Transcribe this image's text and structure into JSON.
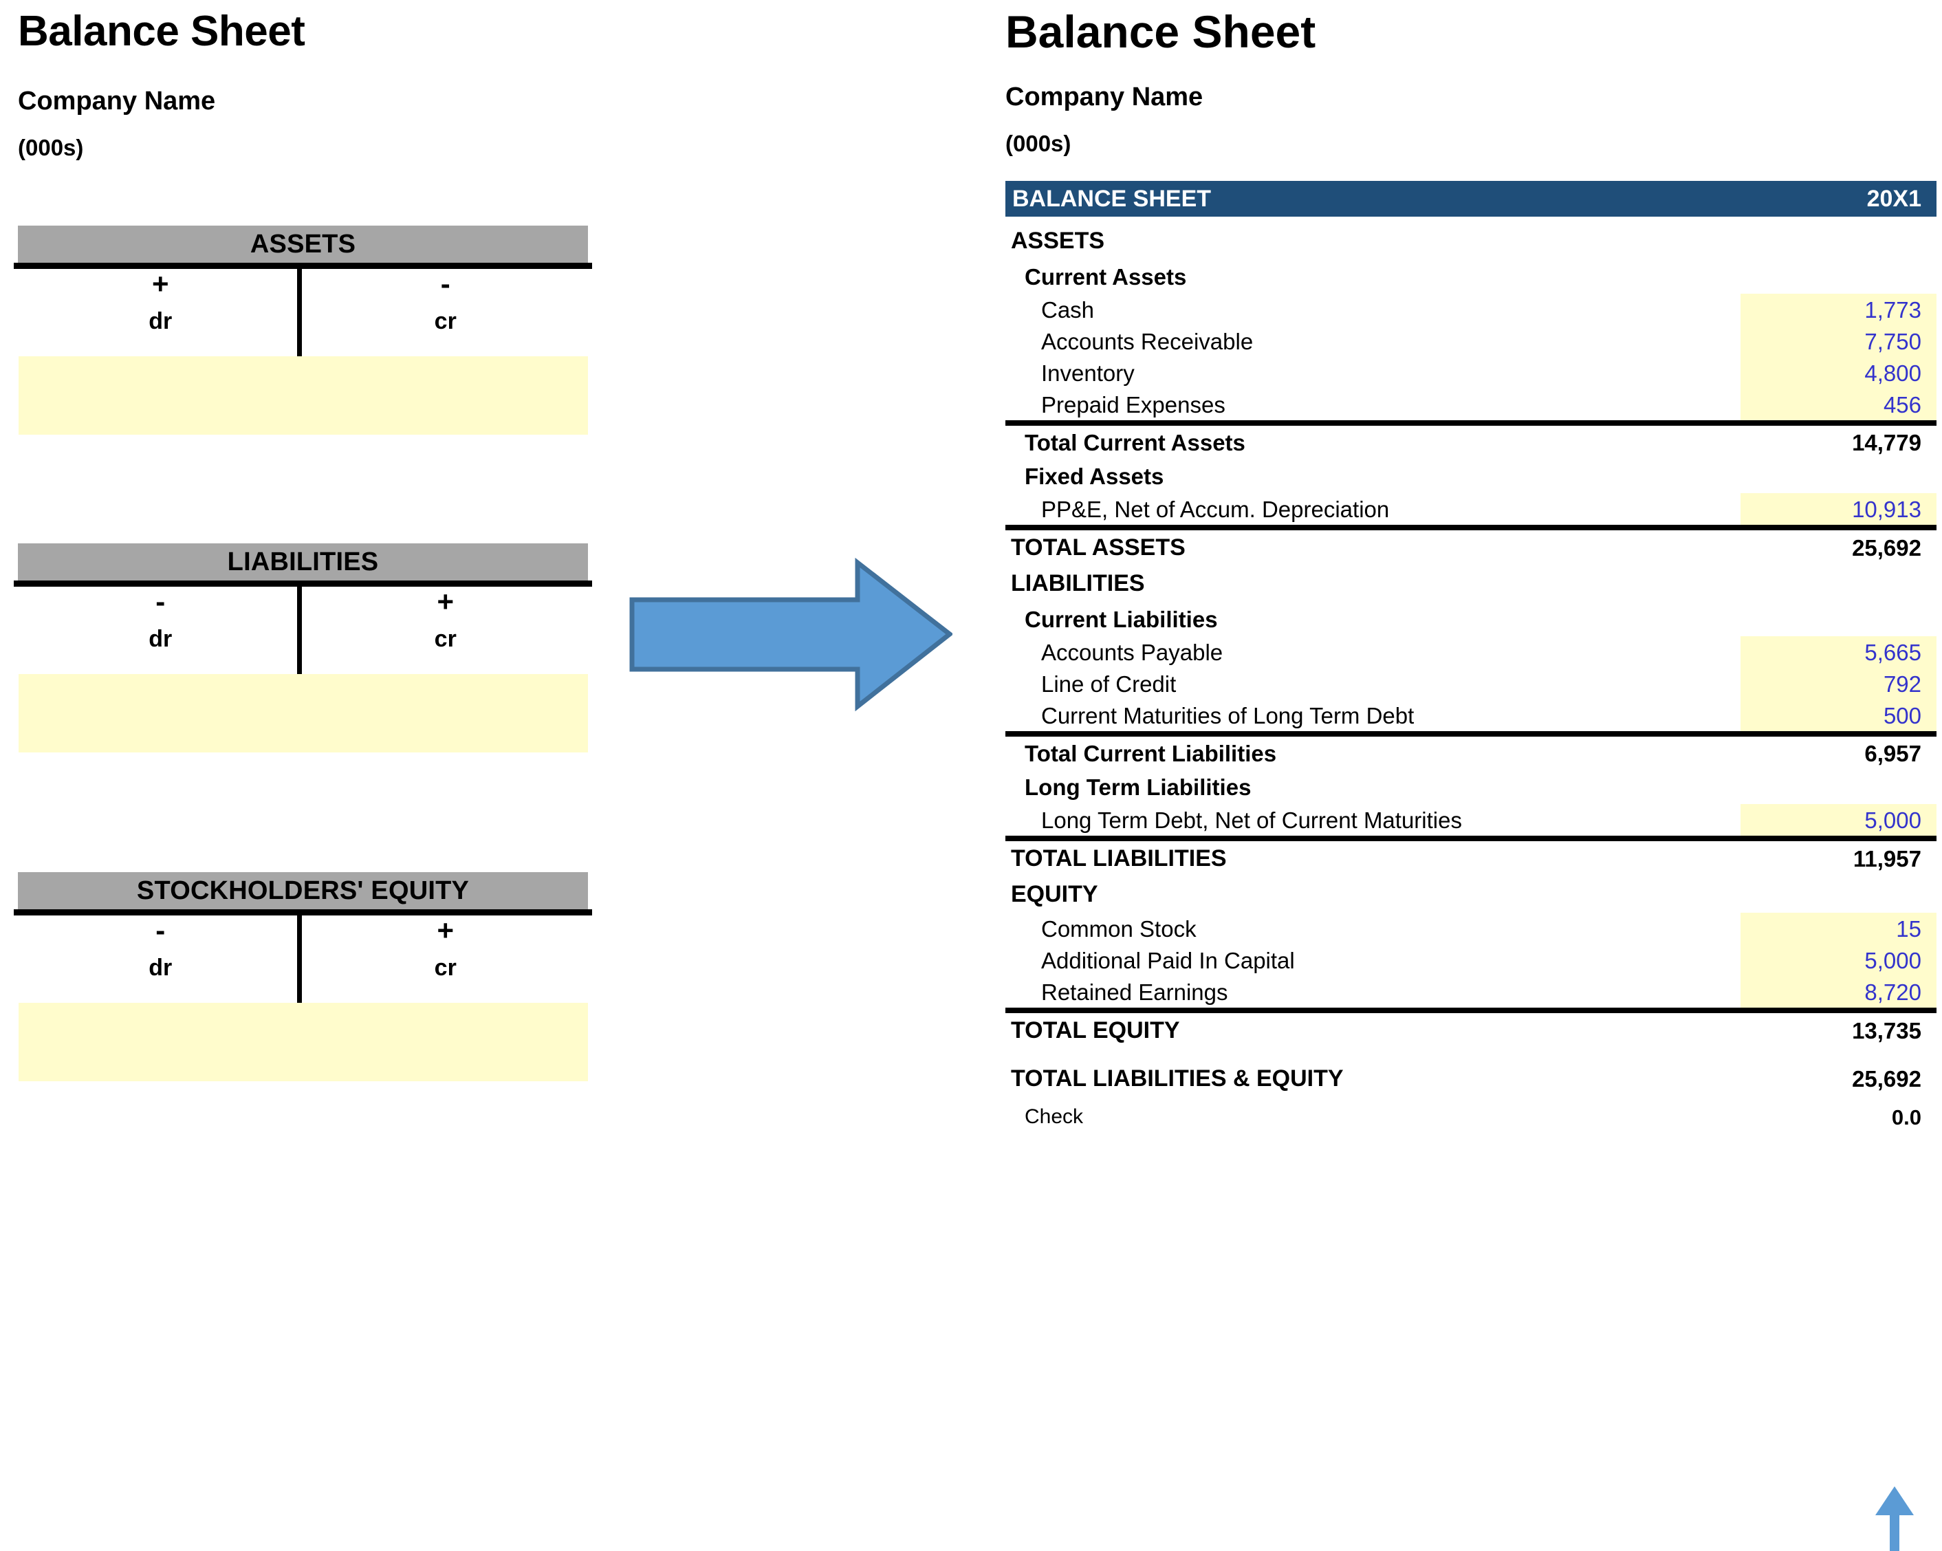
{
  "left": {
    "title": "Balance Sheet",
    "subtitle": "Company Name",
    "units": "(000s)",
    "t_accounts": [
      {
        "name": "ASSETS",
        "debit_sign": "+",
        "debit_label": "dr",
        "credit_sign": "-",
        "credit_label": "cr"
      },
      {
        "name": "LIABILITIES",
        "debit_sign": "-",
        "debit_label": "dr",
        "credit_sign": "+",
        "credit_label": "cr"
      },
      {
        "name": "STOCKHOLDERS' EQUITY",
        "debit_sign": "-",
        "debit_label": "dr",
        "credit_sign": "+",
        "credit_label": "cr"
      }
    ]
  },
  "arrow": {
    "direction": "right",
    "fill": "#5b9bd5",
    "stroke": "#41719c"
  },
  "small_arrow": {
    "direction": "up",
    "fill": "#5b9bd5"
  },
  "right": {
    "title": "Balance Sheet",
    "subtitle": "Company Name",
    "units": "(000s)",
    "header": {
      "label": "BALANCE SHEET",
      "period": "20X1",
      "bg": "#1f4e79",
      "fg": "#ffffff"
    },
    "highlight_color": "#fffccc",
    "input_value_color": "#3333cc",
    "rows": [
      {
        "type": "section",
        "label": "ASSETS",
        "value": ""
      },
      {
        "type": "subsection",
        "label": "Current Assets",
        "value": ""
      },
      {
        "type": "item",
        "label": "Cash",
        "value": "1,773"
      },
      {
        "type": "item",
        "label": "Accounts Receivable",
        "value": "7,750"
      },
      {
        "type": "item",
        "label": "Inventory",
        "value": "4,800"
      },
      {
        "type": "item",
        "label": "Prepaid Expenses",
        "value": "456"
      },
      {
        "type": "total",
        "label": "Total Current Assets",
        "value": "14,779"
      },
      {
        "type": "subsection",
        "label": "Fixed Assets",
        "value": ""
      },
      {
        "type": "item",
        "label": "PP&E, Net of Accum. Depreciation",
        "value": "10,913"
      },
      {
        "type": "grandtotal",
        "label": "TOTAL ASSETS",
        "value": "25,692"
      },
      {
        "type": "section",
        "label": "LIABILITIES",
        "value": ""
      },
      {
        "type": "subsection",
        "label": "Current Liabilities",
        "value": ""
      },
      {
        "type": "item",
        "label": "Accounts Payable",
        "value": "5,665"
      },
      {
        "type": "item",
        "label": "Line of Credit",
        "value": "792"
      },
      {
        "type": "item",
        "label": "Current Maturities of Long Term Debt",
        "value": "500"
      },
      {
        "type": "total",
        "label": "Total Current Liabilities",
        "value": "6,957"
      },
      {
        "type": "subsection",
        "label": "Long Term Liabilities",
        "value": ""
      },
      {
        "type": "item",
        "label": "Long Term Debt, Net of Current Maturities",
        "value": "5,000"
      },
      {
        "type": "grandtotal",
        "label": "TOTAL LIABILITIES",
        "value": "11,957"
      },
      {
        "type": "section",
        "label": "EQUITY",
        "value": ""
      },
      {
        "type": "item",
        "label": "Common Stock",
        "value": "15"
      },
      {
        "type": "item",
        "label": "Additional Paid In Capital",
        "value": "5,000"
      },
      {
        "type": "item",
        "label": "Retained Earnings",
        "value": "8,720"
      },
      {
        "type": "grandtotal",
        "label": "TOTAL EQUITY",
        "value": "13,735"
      },
      {
        "type": "grandtotal-noborder",
        "label": "TOTAL LIABILITIES & EQUITY",
        "value": "25,692"
      },
      {
        "type": "check",
        "label": "Check",
        "value": "0.0"
      }
    ]
  }
}
